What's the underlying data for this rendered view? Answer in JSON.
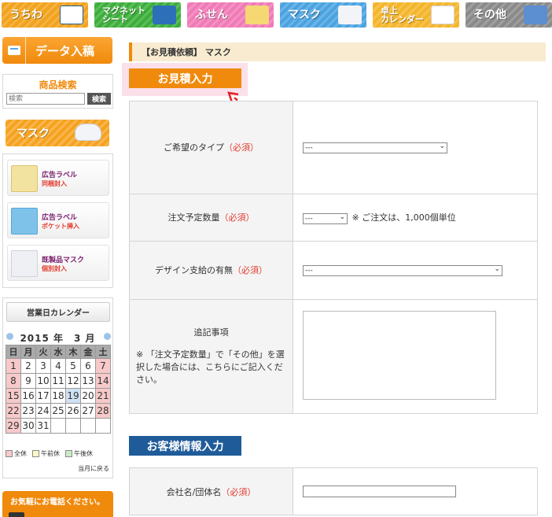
{
  "nav": {
    "tabs": [
      {
        "label": "うちわ",
        "color": "#f2a21c",
        "icon": "uchiwa-image"
      },
      {
        "label": "マグネット\nシート",
        "color": "#3cae3a",
        "icon": "magnet-image"
      },
      {
        "label": "ふせん",
        "color": "#f07ab6",
        "icon": "sticky-note-image"
      },
      {
        "label": "マスク",
        "color": "#4aa3e0",
        "icon": "mask-image"
      },
      {
        "label": "卓上\nカレンダー",
        "color": "#f4b52a",
        "icon": "calendar-image"
      },
      {
        "label": "その他",
        "color": "#8a8a8a",
        "icon": "misc-goods-image"
      }
    ]
  },
  "sidebar": {
    "data_upload_label": "データ入稿",
    "search": {
      "title": "商品検索",
      "placeholder": "検索",
      "button_label": "検索"
    },
    "mask_banner_label": "マスク",
    "promos": [
      {
        "line1": "広告ラベル",
        "line2": "同梱封入"
      },
      {
        "line1": "広告ラベル",
        "line2": "ポケット挿入"
      },
      {
        "line1": "既製品マスク",
        "line2": "個別封入"
      }
    ],
    "calendar": {
      "title": "営業日カレンダー",
      "year_month": "2015 年　3 月",
      "weekdays": [
        "日",
        "月",
        "火",
        "水",
        "木",
        "金",
        "土"
      ],
      "weeks": [
        [
          "1",
          "2",
          "3",
          "4",
          "5",
          "6",
          "7"
        ],
        [
          "8",
          "9",
          "10",
          "11",
          "12",
          "13",
          "14"
        ],
        [
          "15",
          "16",
          "17",
          "18",
          "19",
          "20",
          "21"
        ],
        [
          "22",
          "23",
          "24",
          "25",
          "26",
          "27",
          "28"
        ],
        [
          "29",
          "30",
          "31",
          "",
          "",
          "",
          ""
        ]
      ],
      "holiday_color": "#f7c9c9",
      "today": "19",
      "legend": [
        {
          "label": "全休",
          "color": "#f7c9c9"
        },
        {
          "label": "午前休",
          "color": "#fdf7c4"
        },
        {
          "label": "午後休",
          "color": "#c9ecc1"
        }
      ],
      "back_link": "当月に戻る"
    },
    "phone_banner_label": "お気軽にお電話ください。"
  },
  "main": {
    "breadcrumb": "【お見積依頼】 マスク",
    "section_title": "お見積入力",
    "accent_color": "#f08a0c",
    "fields": {
      "type": {
        "label": "ご希望のタイプ",
        "required": "（必須）",
        "value": "---"
      },
      "qty": {
        "label": "注文予定数量",
        "required": "（必須）",
        "value": "---",
        "note": "※ ご注文は、1,000個単位"
      },
      "design": {
        "label": "デザイン支給の有無",
        "required": "（必須）",
        "value": "---"
      },
      "notes": {
        "label": "追記事項",
        "hint": "※ 「注文予定数量」で「その他」を選択した場合には、こちらにご記入ください。"
      }
    },
    "section2_title": "お客様情報入力",
    "section2_color": "#1f5b99",
    "company": {
      "label": "会社名/団体名",
      "required": "（必須）"
    }
  }
}
